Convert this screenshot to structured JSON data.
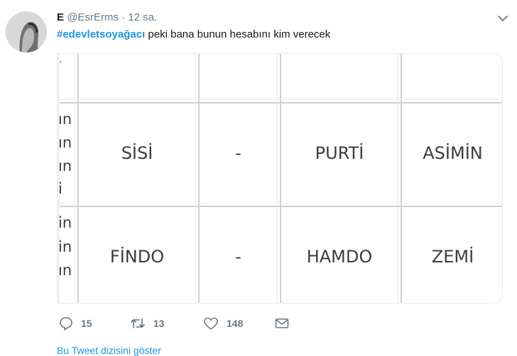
{
  "tweet": {
    "display_name": "E",
    "handle": "@EsrErms",
    "separator": "·",
    "time": "12 sa.",
    "hashtag": "#edevletsoyağacı",
    "body": "peki bana bunun hesabını kim verecek"
  },
  "image_table": {
    "left_fragments": {
      "row1": [
        "ın",
        "ın",
        "ın",
        "i"
      ],
      "row2": [
        "in",
        "in",
        "ın"
      ]
    },
    "rows": [
      [
        "SİSİ",
        "-",
        "PURTİ",
        "ASİMİN"
      ],
      [
        "FİNDO",
        "-",
        "HAMDO",
        "ZEMİ"
      ]
    ]
  },
  "actions": {
    "reply_count": "15",
    "retweet_count": "13",
    "like_count": "148"
  },
  "links": {
    "show_thread": "Bu Tweet dizisini göster"
  },
  "icons": [
    "avatar",
    "chevron-down-icon",
    "reply-icon",
    "retweet-icon",
    "like-icon",
    "message-icon"
  ],
  "colors": {
    "link": "#1b95e0",
    "muted": "#657786",
    "text": "#14171a",
    "table_line": "#cfcfcf"
  }
}
